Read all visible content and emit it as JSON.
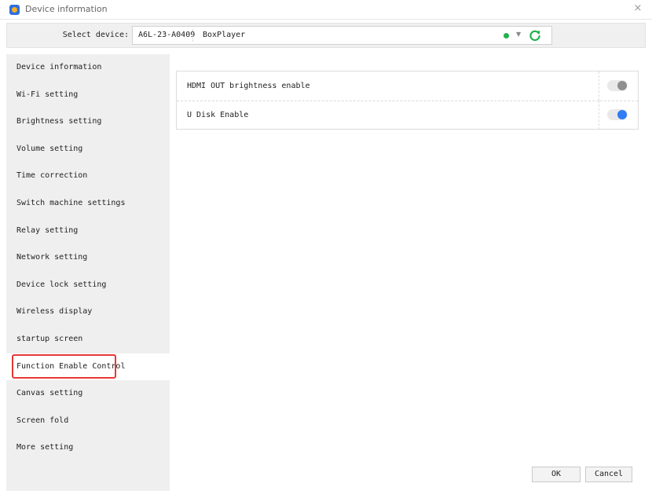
{
  "window": {
    "title": "Device information",
    "close_symbol": "×"
  },
  "device_bar": {
    "label": "Select device:",
    "device_id": "A6L-23-A0409",
    "device_name": "BoxPlayer",
    "status_color": "#22b14c",
    "dropdown_symbol": "▼"
  },
  "sidebar": {
    "items": [
      {
        "label": "Device information"
      },
      {
        "label": "Wi-Fi setting"
      },
      {
        "label": "Brightness setting"
      },
      {
        "label": "Volume setting"
      },
      {
        "label": "Time correction"
      },
      {
        "label": "Switch machine settings"
      },
      {
        "label": "Relay setting"
      },
      {
        "label": "Network setting"
      },
      {
        "label": "Device lock setting"
      },
      {
        "label": "Wireless display"
      },
      {
        "label": "startup screen"
      },
      {
        "label": "Function Enable Control"
      },
      {
        "label": "Canvas setting"
      },
      {
        "label": "Screen fold"
      },
      {
        "label": "More setting"
      }
    ],
    "active_index": 11
  },
  "settings": {
    "rows": [
      {
        "label": "HDMI OUT brightness enable",
        "enabled": false
      },
      {
        "label": "U Disk Enable",
        "enabled": true
      }
    ]
  },
  "footer": {
    "ok_label": "OK",
    "cancel_label": "Cancel"
  },
  "colors": {
    "accent": "#2f7cf6",
    "highlight": "#e53935",
    "refresh": "#22b14c"
  }
}
